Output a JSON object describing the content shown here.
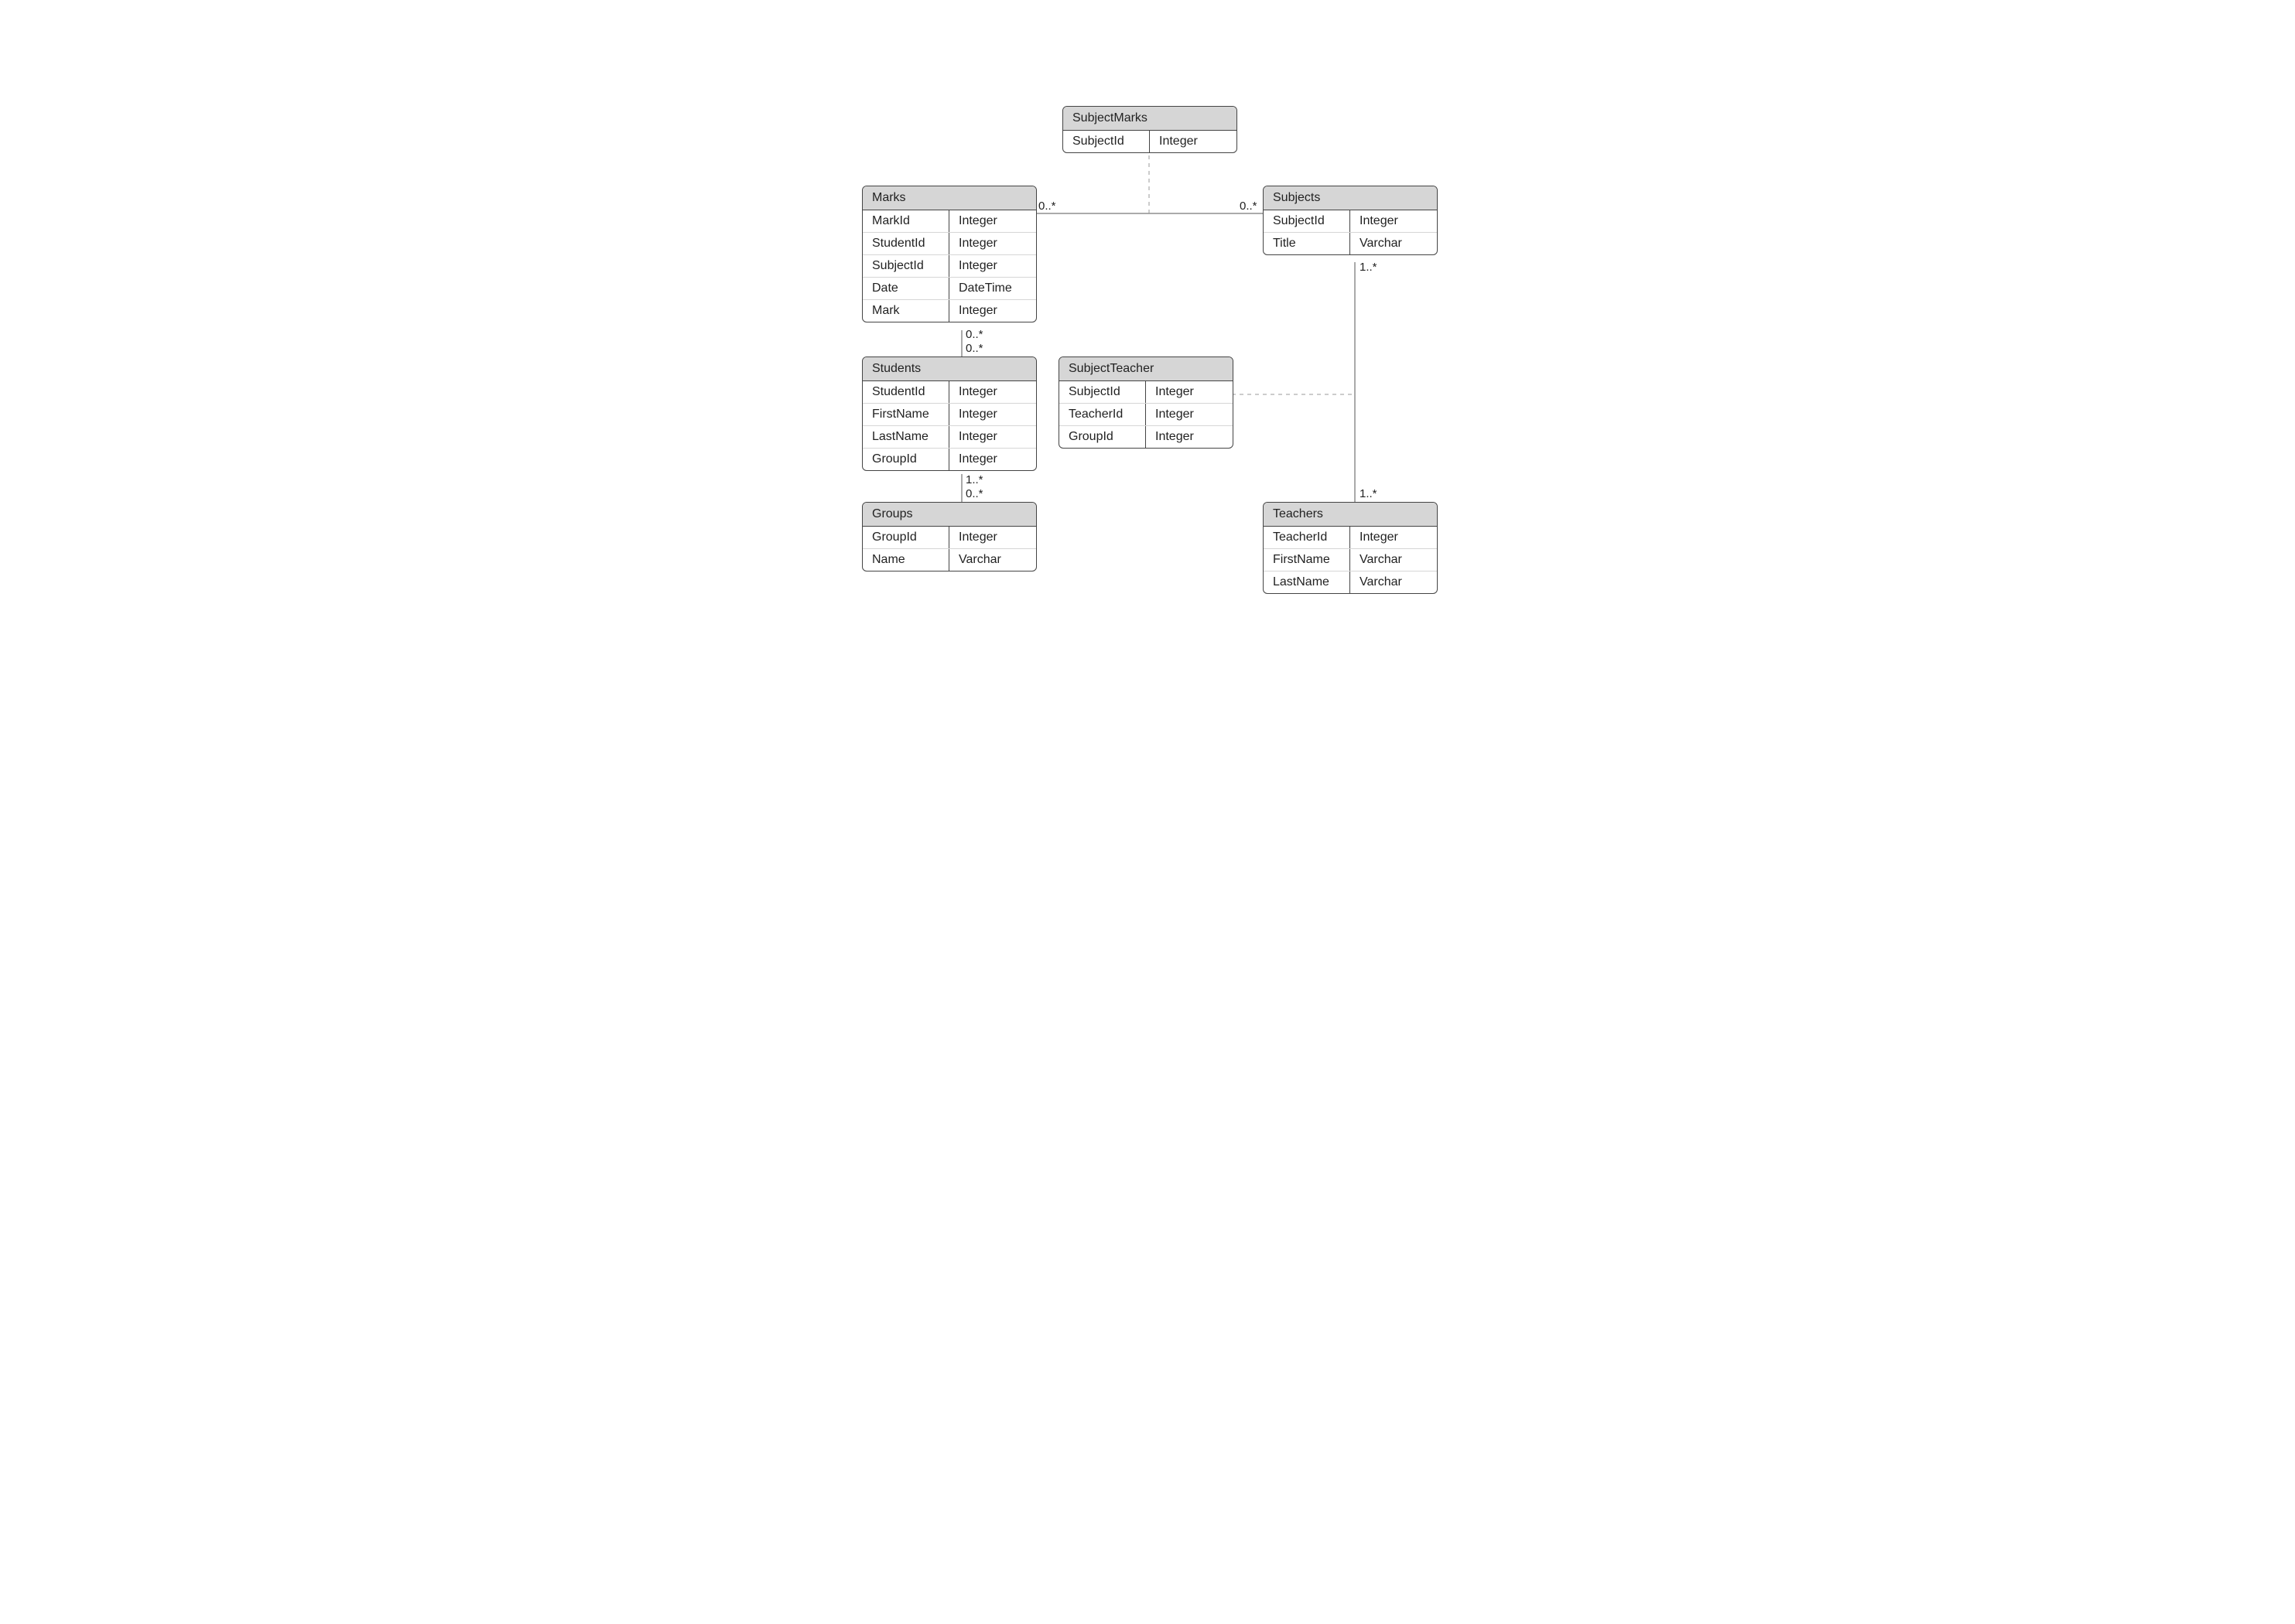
{
  "entities": {
    "subjectMarks": {
      "title": "SubjectMarks",
      "rows": [
        {
          "name": "SubjectId",
          "type": "Integer"
        }
      ]
    },
    "marks": {
      "title": "Marks",
      "rows": [
        {
          "name": "MarkId",
          "type": "Integer"
        },
        {
          "name": "StudentId",
          "type": "Integer"
        },
        {
          "name": "SubjectId",
          "type": "Integer"
        },
        {
          "name": "Date",
          "type": "DateTime"
        },
        {
          "name": "Mark",
          "type": "Integer"
        }
      ]
    },
    "subjects": {
      "title": "Subjects",
      "rows": [
        {
          "name": "SubjectId",
          "type": "Integer"
        },
        {
          "name": "Title",
          "type": "Varchar"
        }
      ]
    },
    "students": {
      "title": "Students",
      "rows": [
        {
          "name": "StudentId",
          "type": "Integer"
        },
        {
          "name": "FirstName",
          "type": "Integer"
        },
        {
          "name": "LastName",
          "type": "Integer"
        },
        {
          "name": "GroupId",
          "type": "Integer"
        }
      ]
    },
    "subjectTeacher": {
      "title": "SubjectTeacher",
      "rows": [
        {
          "name": "SubjectId",
          "type": "Integer"
        },
        {
          "name": "TeacherId",
          "type": "Integer"
        },
        {
          "name": "GroupId",
          "type": "Integer"
        }
      ]
    },
    "groups": {
      "title": "Groups",
      "rows": [
        {
          "name": "GroupId",
          "type": "Integer"
        },
        {
          "name": "Name",
          "type": "Varchar"
        }
      ]
    },
    "teachers": {
      "title": "Teachers",
      "rows": [
        {
          "name": "TeacherId",
          "type": "Integer"
        },
        {
          "name": "FirstName",
          "type": "Varchar"
        },
        {
          "name": "LastName",
          "type": "Varchar"
        }
      ]
    }
  },
  "multiplicity": {
    "marks_subjects_left": "0..*",
    "marks_subjects_right": "0..*",
    "marks_students_top": "0..*",
    "marks_students_bottom": "0..*",
    "students_groups_top": "1..*",
    "students_groups_bottom": "0..*",
    "subjects_teachers_top": "1..*",
    "subjects_teachers_bottom": "1..*"
  }
}
